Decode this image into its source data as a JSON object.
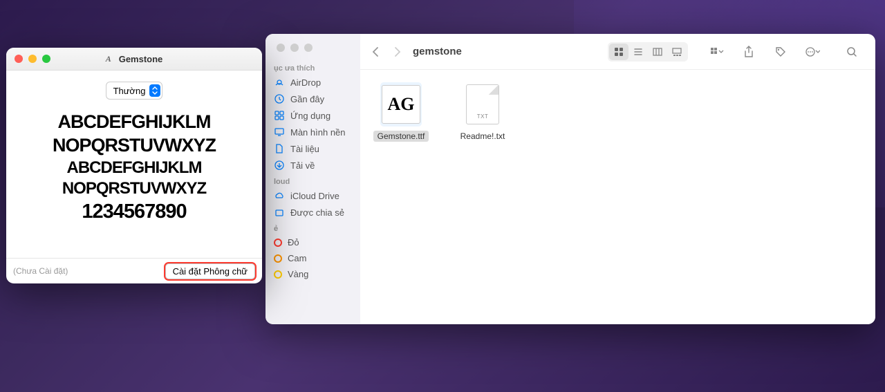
{
  "fontWindow": {
    "title": "Gemstone",
    "styleSelector": "Thường",
    "previewLines": {
      "line1": "ABCDEFGHIJKLM",
      "line2": "NOPQRSTUVWXYZ",
      "line3": "ABCDEFGHIJKLM",
      "line4": "NOPQRSTUVWXYZ",
      "line5": "1234567890"
    },
    "statusText": "(Chưa Cài đặt)",
    "installButton": "Cài đặt Phông chữ"
  },
  "finder": {
    "folderName": "gemstone",
    "sidebar": {
      "favoritesHeader": "ục ưa thích",
      "items": [
        {
          "icon": "airdrop",
          "label": "AirDrop"
        },
        {
          "icon": "clock",
          "label": "Gần đây"
        },
        {
          "icon": "apps",
          "label": "Ứng dụng"
        },
        {
          "icon": "desktop",
          "label": "Màn hình nền"
        },
        {
          "icon": "document",
          "label": "Tài liệu"
        },
        {
          "icon": "download",
          "label": "Tải về"
        }
      ],
      "icloudHeader": "loud",
      "icloudItems": [
        {
          "icon": "cloud",
          "label": "iCloud Drive"
        },
        {
          "icon": "shared",
          "label": "Được chia sẻ"
        }
      ],
      "tagsHeader": "ẻ",
      "tags": [
        {
          "color": "#ff3b30",
          "label": "Đỏ"
        },
        {
          "color": "#ff9500",
          "label": "Cam"
        },
        {
          "color": "#ffcc00",
          "label": "Vàng"
        }
      ]
    },
    "files": [
      {
        "name": "Gemstone.ttf",
        "type": "ttf",
        "selected": true
      },
      {
        "name": "Readme!.txt",
        "type": "txt",
        "selected": false
      }
    ],
    "txtIconLabel": "TXT",
    "ttfIconText": "AG"
  }
}
